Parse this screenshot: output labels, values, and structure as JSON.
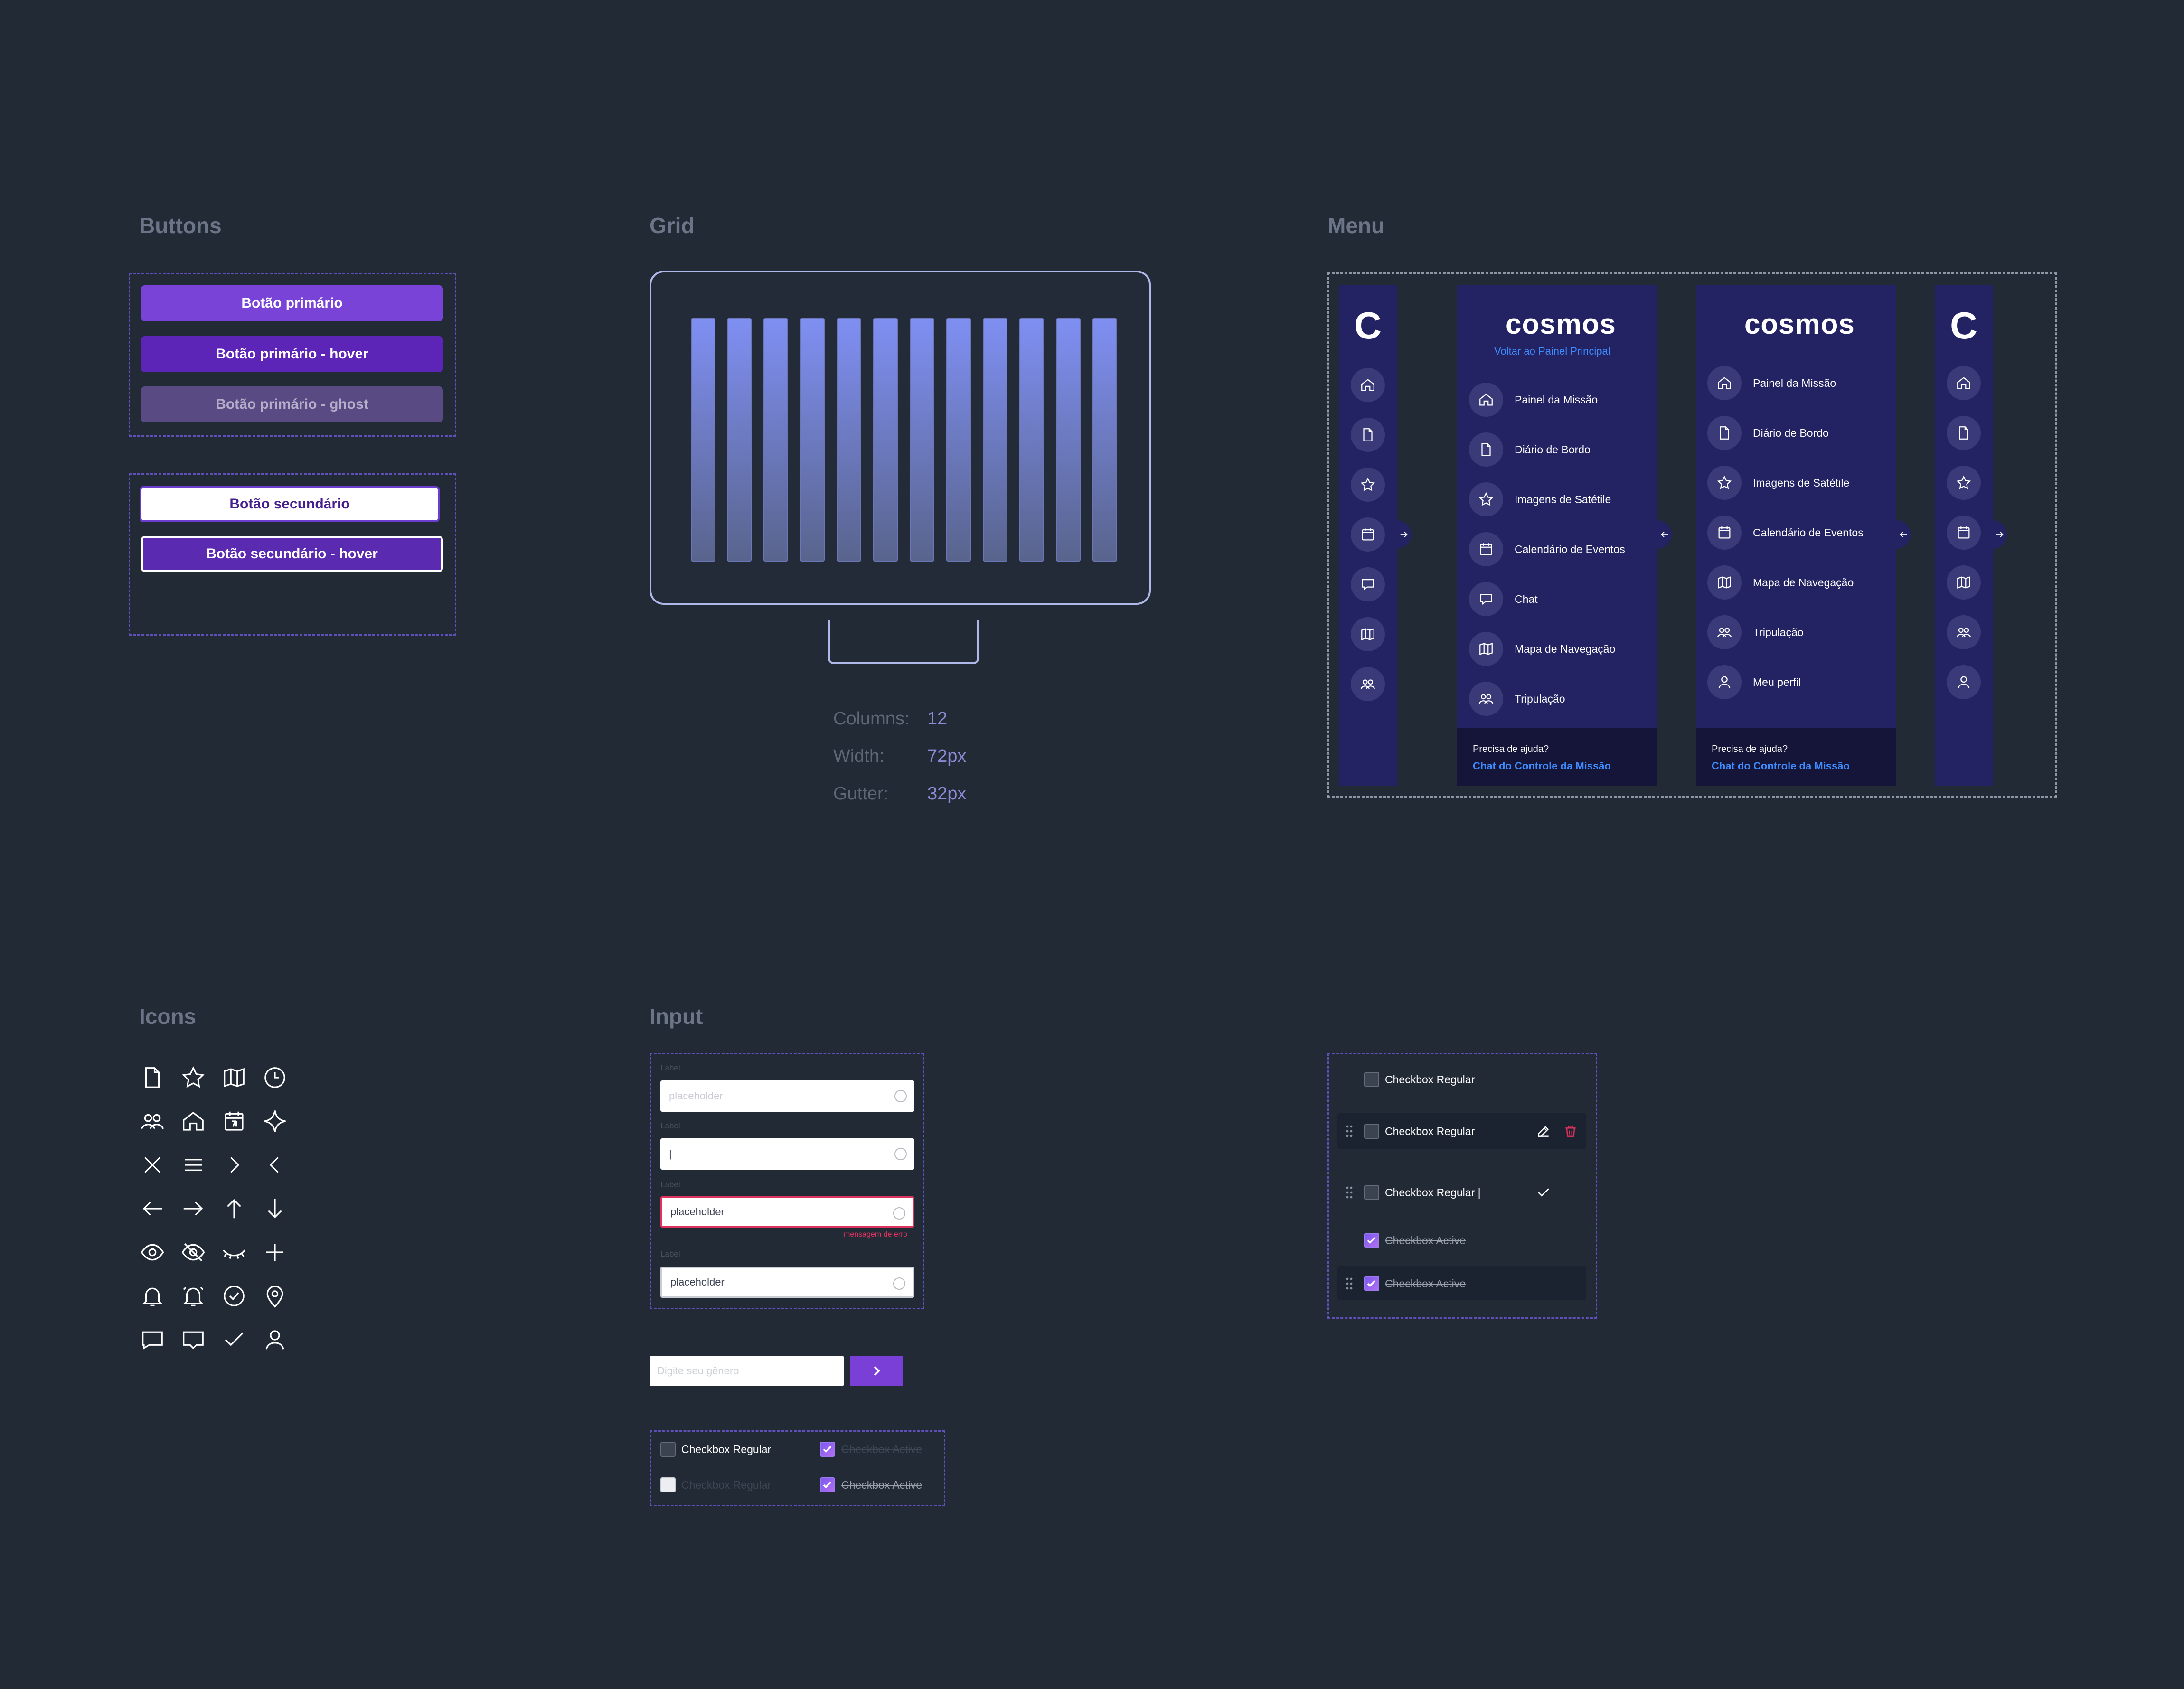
{
  "sections": {
    "buttons": "Buttons",
    "grid": "Grid",
    "menu": "Menu",
    "icons": "Icons",
    "input": "Input"
  },
  "buttons": {
    "primary": "Botão primário",
    "primary_hover": "Botão primário - hover",
    "primary_ghost": "Botão primário - ghost",
    "secondary": "Botão secundário",
    "secondary_hover": "Botão secundário - hover"
  },
  "grid": {
    "columns_label": "Columns:",
    "columns_value": "12",
    "width_label": "Width:",
    "width_value": "72px",
    "gutter_label": "Gutter:",
    "gutter_value": "32px"
  },
  "menu": {
    "brand": "cosmos",
    "logo_letter": "C",
    "back_link": "Voltar ao Painel Principal",
    "expanded_a_items": [
      "Painel da Missão",
      "Diário de Bordo",
      "Imagens de Satétile",
      "Calendário de Eventos",
      "Chat",
      "Mapa de Navegação",
      "Tripulação"
    ],
    "expanded_b_items": [
      "Painel da Missão",
      "Diário de Bordo",
      "Imagens de Satétile",
      "Calendário de Eventos",
      "Mapa de Navegação",
      "Tripulação",
      "Meu perfil"
    ],
    "help_question": "Precisa de ajuda?",
    "help_link": "Chat do Controle da Missão"
  },
  "inputs": {
    "label": "Label",
    "placeholder": "placeholder",
    "cursor": "|",
    "error_message": "mensagem de erro",
    "search_placeholder": "Digite seu gênero"
  },
  "checkboxes": {
    "regular": "Checkbox Regular",
    "regular_editing": "Checkbox Regular |",
    "active": "Checkbox Active"
  },
  "colors": {
    "background": "#212a35",
    "primary": "#7a43d8",
    "primary_hover": "#5c25b8",
    "menu_bg": "#232363",
    "link": "#3f8cff",
    "error": "#e0325e"
  }
}
